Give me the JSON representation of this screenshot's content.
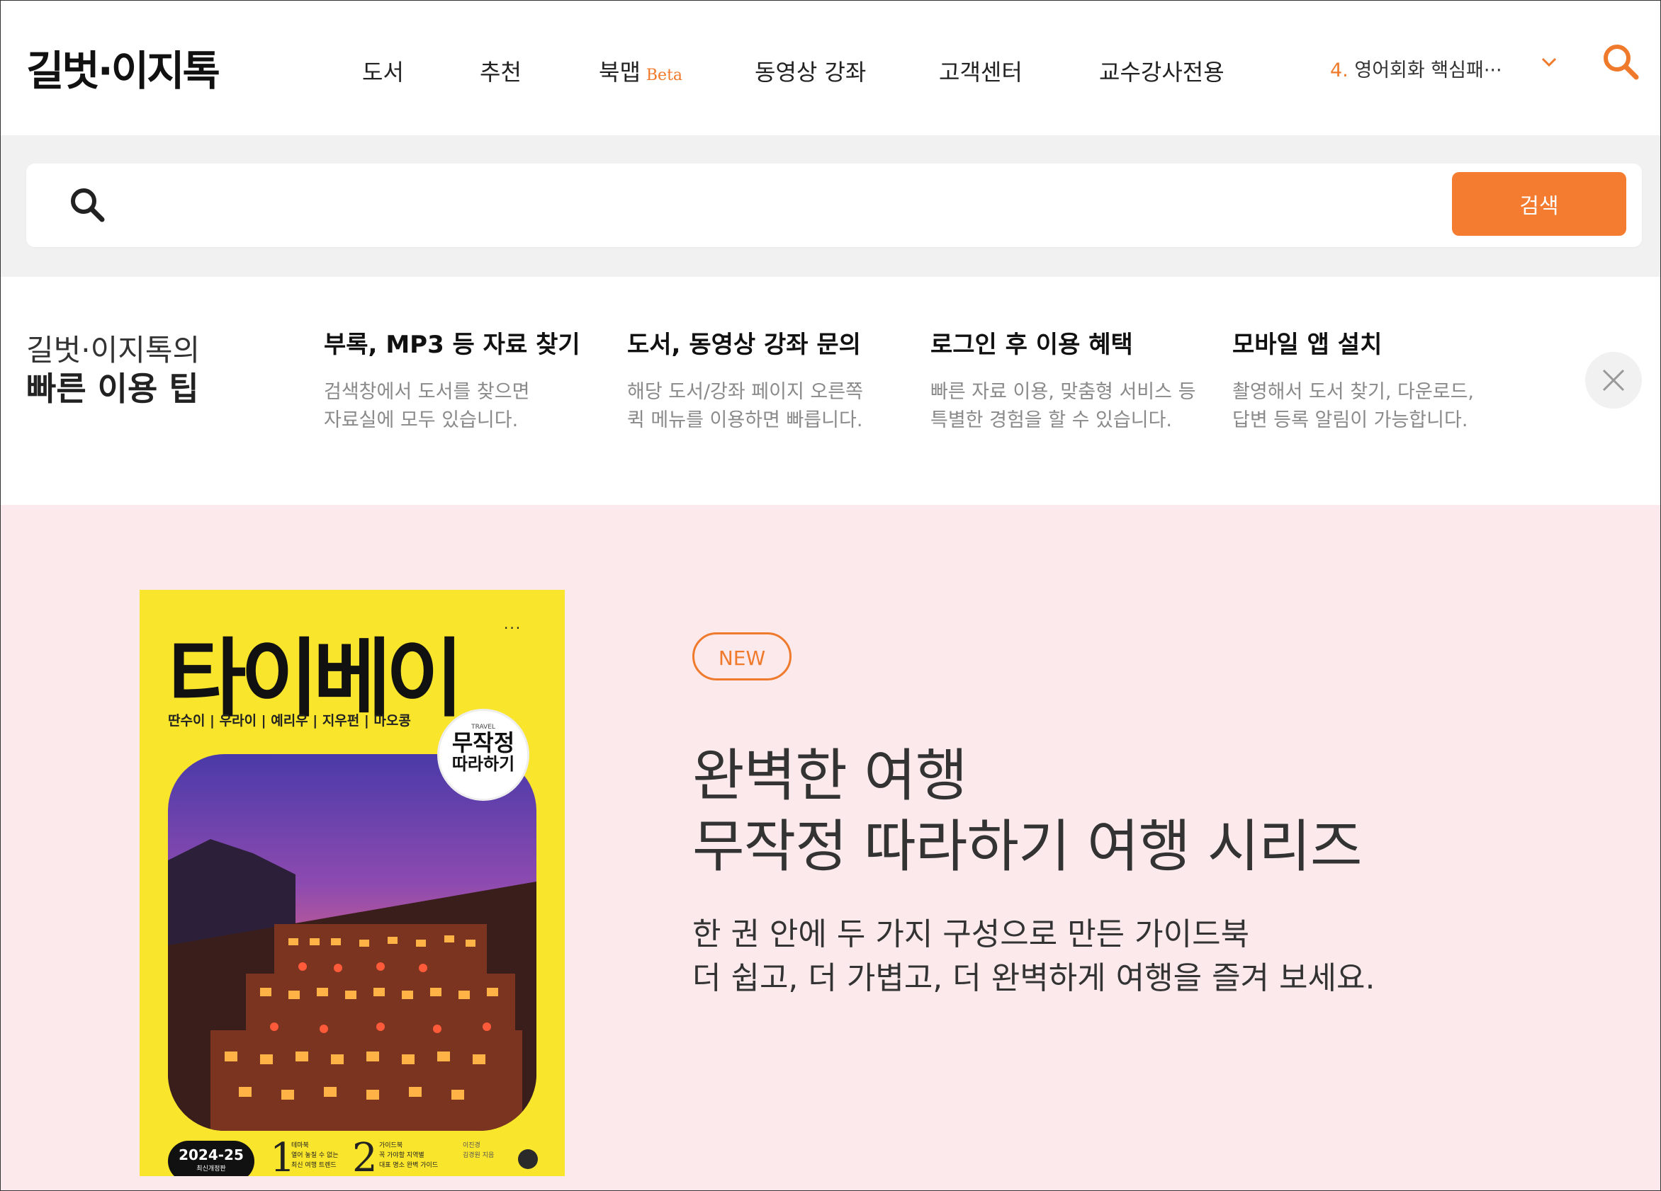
{
  "header": {
    "logo": "길벗·이지톡",
    "nav": [
      {
        "label": "도서"
      },
      {
        "label": "추천"
      },
      {
        "label": "북맵",
        "badge": "Beta"
      },
      {
        "label": "동영상 강좌"
      },
      {
        "label": "고객센터"
      },
      {
        "label": "교수강사전용"
      }
    ],
    "recent_search": {
      "rank": "4.",
      "text": "영어회화 핵심패···"
    },
    "icons": [
      "chevron-down-icon",
      "search-icon"
    ],
    "accent_color": "#f07a2c"
  },
  "search": {
    "value": "",
    "placeholder": "",
    "button_label": "검색",
    "button_color": "#f47c30"
  },
  "tips": {
    "title_line1": "길벗·이지톡의",
    "title_line2": "빠른 이용 팁",
    "items": [
      {
        "heading": "부록, MP3 등 자료 찾기",
        "line1": "검색창에서 도서를 찾으면",
        "line2": "자료실에 모두 있습니다."
      },
      {
        "heading": "도서, 동영상 강좌 문의",
        "line1": "해당 도서/강좌 페이지 오른쪽",
        "line2": "퀵 메뉴를 이용하면 빠릅니다."
      },
      {
        "heading": "로그인 후 이용 혜택",
        "line1": "빠른 자료 이용, 맞춤형 서비스 등",
        "line2": "특별한 경험을 할 수 있습니다."
      },
      {
        "heading": "모바일 앱 설치",
        "line1": "촬영해서 도서 찾기, 다운로드,",
        "line2": "답변 등록 알림이 가능합니다."
      }
    ],
    "close_icon": "close-icon"
  },
  "promo": {
    "badge": "NEW",
    "headline_line1": "완벽한 여행",
    "headline_line2": "무작정 따라하기 여행 시리즈",
    "desc_line1": "한 권 안에 두 가지 구성으로 만든 가이드북",
    "desc_line2": "더 쉽고, 더 가볍고, 더 완벽하게 여행을 즐겨 보세요.",
    "background_color": "#fbe9ec",
    "book": {
      "title": "타이베이",
      "dots": "···",
      "places": "딴수이 | 우라이 | 예리우 | 지우펀 | 마오콩",
      "badge_small": "TRAVEL",
      "badge_line1": "무작정",
      "badge_line2": "따라하기",
      "edition_year": "2024-25",
      "edition_note": "최신개정판",
      "part1_num": "1",
      "part1_title": "테마북",
      "part1_desc1": "열어 놓칠 수 없는",
      "part1_desc2": "최신 여행 트렌드",
      "part2_num": "2",
      "part2_title": "가이드북",
      "part2_desc1": "꼭 가야할 지역별",
      "part2_desc2": "대표 명소 완벽 가이드",
      "authors1": "이진경",
      "authors2": "김경원 지음",
      "cover_color": "#f9e52b"
    }
  }
}
